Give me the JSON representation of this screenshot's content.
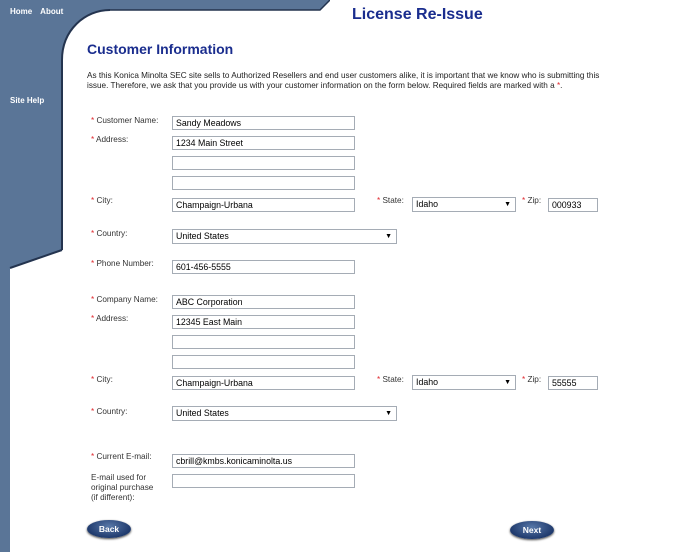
{
  "nav": {
    "home": "Home",
    "about": "About",
    "site_help": "Site Help"
  },
  "page_title": "License Re-Issue",
  "section_title": "Customer Information",
  "intro_text": "As this Konica Minolta SEC site sells to Authorized Resellers and end user customers alike, it is important that we know who is submitting this issue. Therefore, we ask that you provide us with your customer information on the form below. Required fields are marked with a ",
  "intro_star": "*",
  "intro_end": ".",
  "required_marker": "*",
  "customer": {
    "name_label": "Customer Name:",
    "name_value": "Sandy Meadows",
    "address_label": "Address:",
    "address1": "1234 Main Street",
    "address2": "",
    "address3": "",
    "city_label": "City:",
    "city_value": "Champaign-Urbana",
    "state_label": "State:",
    "state_value": "Idaho",
    "zip_label": "Zip:",
    "zip_value": "000933",
    "country_label": "Country:",
    "country_value": "United States",
    "phone_label": "Phone Number:",
    "phone_value": "601-456-5555"
  },
  "company": {
    "name_label": "Company Name:",
    "name_value": "ABC Corporation",
    "address_label": "Address:",
    "address1": "12345 East Main",
    "address2": "",
    "address3": "",
    "city_label": "City:",
    "city_value": "Champaign-Urbana",
    "state_label": "State:",
    "state_value": "Idaho",
    "zip_label": "Zip:",
    "zip_value": "55555",
    "country_label": "Country:",
    "country_value": "United States"
  },
  "email": {
    "current_label": "Current E-mail:",
    "current_value": "cbrill@kmbs.konicaminolta.us",
    "original_label_1": "E-mail used for",
    "original_label_2": "original purchase",
    "original_label_3": "(if different):",
    "original_value": ""
  },
  "buttons": {
    "back": "Back",
    "next": "Next"
  },
  "colors": {
    "sidebar": "#5a7597",
    "title": "#1a2d8e",
    "required": "#e0282e",
    "button": "#1f3a6d"
  }
}
